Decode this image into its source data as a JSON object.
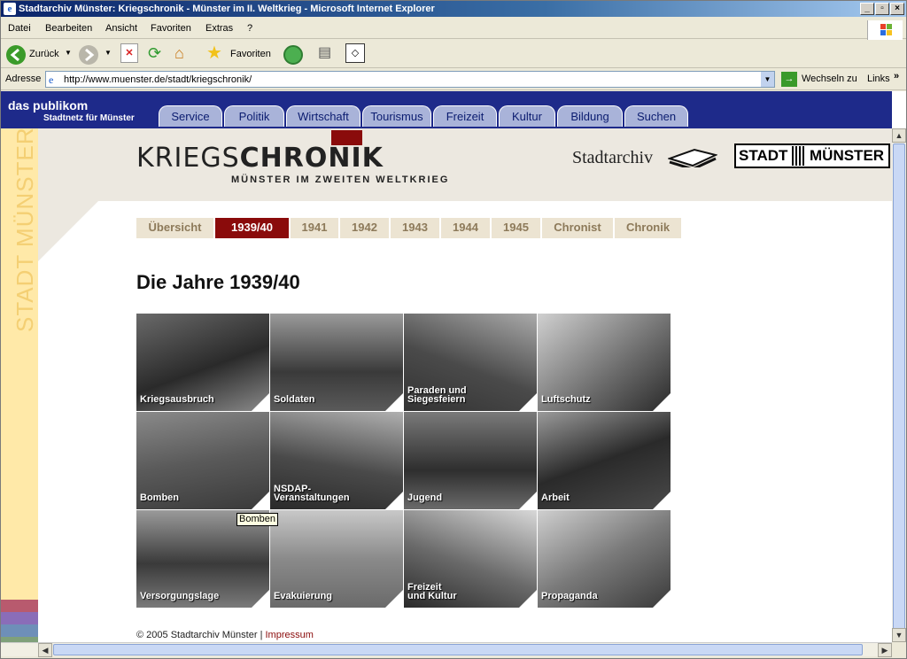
{
  "window": {
    "title": "Stadtarchiv Münster: Kriegschronik - Münster im II. Weltkrieg - Microsoft Internet Explorer"
  },
  "menu": [
    "Datei",
    "Bearbeiten",
    "Ansicht",
    "Favoriten",
    "Extras",
    "?"
  ],
  "toolbar": {
    "back": "Zurück",
    "favorites": "Favoriten"
  },
  "address": {
    "label": "Adresse",
    "url": "http://www.muenster.de/stadt/kriegschronik/",
    "go": "Wechseln zu",
    "links": "Links"
  },
  "portal": {
    "logo": "das publikom",
    "tagline": "Stadtnetz für Münster",
    "nav": [
      "Service",
      "Politik",
      "Wirtschaft",
      "Tourismus",
      "Freizeit",
      "Kultur",
      "Bildung",
      "Suchen"
    ]
  },
  "sidebar": {
    "text": "STADT MÜNSTER"
  },
  "header": {
    "title_light": "KRIEGS",
    "title_bold": "CHRONIK",
    "subtitle": "MÜNSTER IM ZWEITEN WELTKRIEG",
    "archive": "Stadtarchiv",
    "city_a": "STADT",
    "city_b": "MÜNSTER"
  },
  "years": {
    "tabs": [
      "Übersicht",
      "1939/40",
      "1941",
      "1942",
      "1943",
      "1944",
      "1945",
      "Chronist",
      "Chronik"
    ],
    "active": "1939/40"
  },
  "page": {
    "heading": "Die Jahre 1939/40"
  },
  "tiles": [
    {
      "label": "Kriegsausbruch"
    },
    {
      "label": "Soldaten"
    },
    {
      "label": "Paraden und\nSiegesfeiern"
    },
    {
      "label": "Luftschutz"
    },
    {
      "label": "Bomben"
    },
    {
      "label": "NSDAP-\nVeranstaltungen"
    },
    {
      "label": "Jugend"
    },
    {
      "label": "Arbeit"
    },
    {
      "label": "Versorgungslage"
    },
    {
      "label": "Evakuierung"
    },
    {
      "label": "Freizeit\nund Kultur"
    },
    {
      "label": "Propaganda"
    }
  ],
  "tooltip": "Bomben",
  "footer": {
    "copyright": "© 2005 Stadtarchiv Münster |",
    "link": "Impressum"
  }
}
